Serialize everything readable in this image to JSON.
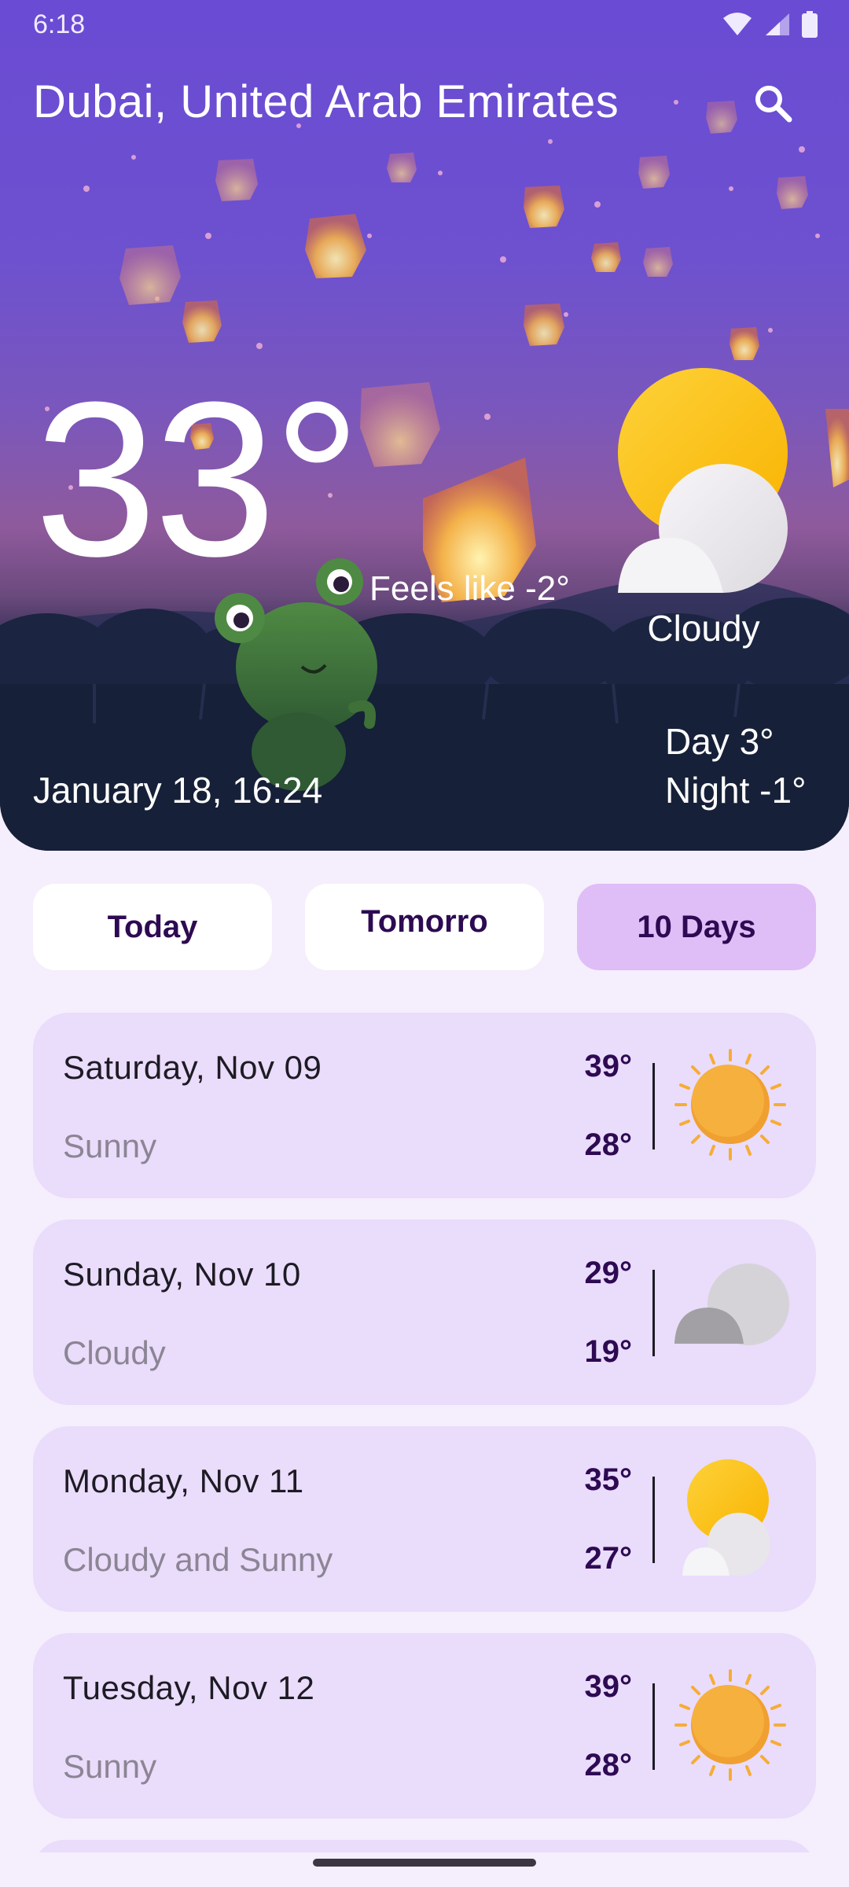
{
  "status_bar": {
    "time": "6:18"
  },
  "header": {
    "location": "Dubai, United Arab Emirates",
    "search_icon": "search-icon"
  },
  "current": {
    "temperature": "33°",
    "feels_like": "Feels like -2°",
    "condition": "Cloudy",
    "datetime": "January 18, 16:24",
    "day": "Day 3°",
    "night": "Night -1°"
  },
  "tabs": [
    {
      "label": "Today",
      "selected": false
    },
    {
      "label": "Tomorro",
      "selected": false
    },
    {
      "label": "10 Days",
      "selected": true
    }
  ],
  "forecast": [
    {
      "day": "Saturday, Nov 09",
      "condition": "Sunny",
      "high": "39°",
      "low": "28°",
      "icon": "sunny-icon"
    },
    {
      "day": "Sunday, Nov 10",
      "condition": "Cloudy",
      "high": "29°",
      "low": "19°",
      "icon": "cloudy-icon"
    },
    {
      "day": "Monday, Nov 11",
      "condition": "Cloudy and Sunny",
      "high": "35°",
      "low": "27°",
      "icon": "partly-sunny-icon"
    },
    {
      "day": "Tuesday, Nov 12",
      "condition": "Sunny",
      "high": "39°",
      "low": "28°",
      "icon": "sunny-icon"
    }
  ],
  "colors": {
    "hero_top": "#6a4bd4",
    "background": "#f5eefc",
    "card": "#eadcfb",
    "selected_tab": "#dfbdf7",
    "accent_text": "#2d0a52",
    "sun": "#f6ad36"
  }
}
